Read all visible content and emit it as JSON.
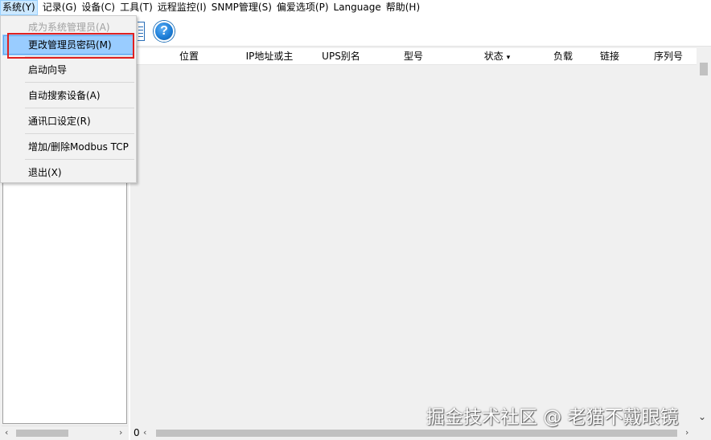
{
  "menubar": {
    "items": [
      {
        "label": "系统(Y)"
      },
      {
        "label": "记录(G)"
      },
      {
        "label": "设备(C)"
      },
      {
        "label": "工具(T)"
      },
      {
        "label": "远程监控(I)"
      },
      {
        "label": "SNMP管理(S)"
      },
      {
        "label": "偏爱选项(P)"
      },
      {
        "label": "Language"
      },
      {
        "label": "帮助(H)"
      }
    ]
  },
  "toolbar": {
    "help_glyph": "?"
  },
  "system_menu": {
    "items": [
      {
        "label": "成为系统管理员(A)",
        "disabled": true
      },
      {
        "label": "更改管理员密码(M)",
        "highlighted": true
      },
      {
        "label": "启动向导"
      },
      {
        "label": "自动搜索设备(A)"
      },
      {
        "label": "通讯口设定(R)"
      },
      {
        "label": "增加/删除Modbus TCP"
      },
      {
        "label": "退出(X)"
      }
    ]
  },
  "table": {
    "columns": [
      {
        "label": "位置"
      },
      {
        "label": "IP地址或主"
      },
      {
        "label": "UPS别名"
      },
      {
        "label": "型号"
      },
      {
        "label": "状态"
      },
      {
        "label": "负载"
      },
      {
        "label": "链接"
      },
      {
        "label": "序列号"
      }
    ],
    "sort_indicator": "▾",
    "scroll_position": "0"
  },
  "watermark": "掘金技术社区 @ 老猫不戴眼镜",
  "colors": {
    "menu_highlight": "#99ccff",
    "annotation_red": "#e02020",
    "help_icon_blue": "#1e7fd8"
  }
}
